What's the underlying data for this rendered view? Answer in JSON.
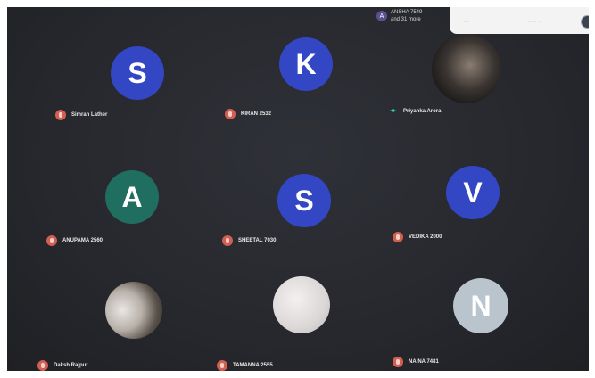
{
  "overflow": {
    "initial": "A",
    "line1": "ANSHA 7549",
    "line2": "and 31 more"
  },
  "topbar": {
    "item1": "···",
    "item2": "·· ·· ··"
  },
  "participants": [
    {
      "initial": "S",
      "name": "Simran Lather",
      "color": "#3346c4"
    },
    {
      "initial": "K",
      "name": "KIRAN 2532",
      "color": "#3346c4"
    },
    {
      "initial": "",
      "name": "Priyanka Arora",
      "color": "#3a3230",
      "speaking": true
    },
    {
      "initial": "A",
      "name": "ANUPAMA 2560",
      "color": "#1f6e60"
    },
    {
      "initial": "S",
      "name": "SHEETAL 7030",
      "color": "#3346c4"
    },
    {
      "initial": "V",
      "name": "VEDIKA 2000",
      "color": "#3346c4"
    },
    {
      "initial": "",
      "name": "Daksh Rajput",
      "color": "#3a3230"
    },
    {
      "initial": "",
      "name": "TAMANNA 2555",
      "color": "#dddada"
    },
    {
      "initial": "N",
      "name": "NAINA 7481",
      "color": "#b9c4cc"
    }
  ]
}
